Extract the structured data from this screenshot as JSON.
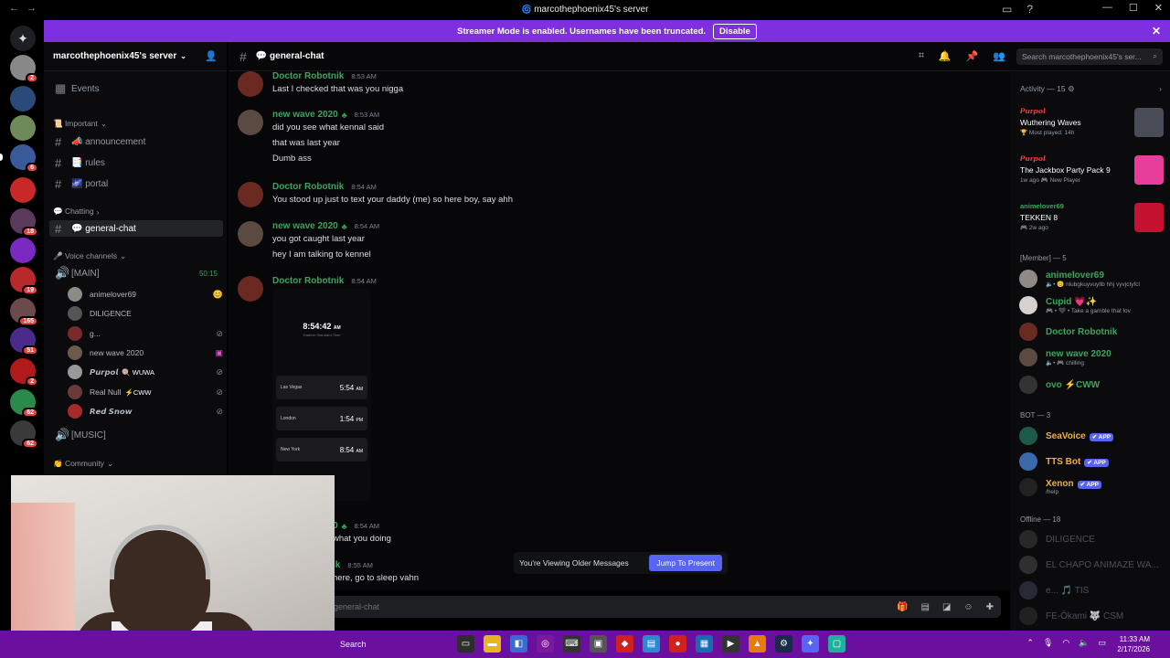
{
  "window": {
    "title": "marcothephoenix45's server"
  },
  "banner": {
    "text": "Streamer Mode is enabled. Usernames have been truncated.",
    "disable_label": "Disable"
  },
  "rail_badges": [
    "2",
    "6",
    "18",
    "19",
    "165",
    "51",
    "2",
    "62",
    "62"
  ],
  "server": {
    "name": "marcothephoenix45's server"
  },
  "channels": {
    "events_label": "Events",
    "important_label": "📜 Important",
    "announcement": "📣 announcement",
    "rules": "📑 rules",
    "portal": "🌌 portal",
    "chatting_label": "💬 Chatting",
    "general": "💬 general-chat",
    "voice_label": "🎤 Voice channels",
    "main_voice": "[MAIN]",
    "main_timer": "50:15",
    "music_voice": "[MUSIC]",
    "community_label": "👏 Community"
  },
  "voice_users": [
    {
      "name": "animelover69",
      "color": "#8e8a86"
    },
    {
      "name": "DILIGENCE",
      "color": "#555"
    },
    {
      "name": "g...",
      "color": "#7a2a2a"
    },
    {
      "name": "new wave 2020",
      "color": "#6b5a4a"
    },
    {
      "name": "𝙋𝙪𝙧𝙥𝙤𝙡",
      "tag": "🍭 WUWA",
      "color": "#999"
    },
    {
      "name": "Real Null",
      "tag": "⚡CWW",
      "color": "#6a3a3a"
    },
    {
      "name": "𝙍𝙚𝙙 𝙎𝙣𝙤𝙬",
      "color": "#a52a2a"
    }
  ],
  "chat": {
    "channel_name": "💬 general-chat",
    "search_placeholder": "Search marcothephoenix45's ser...",
    "messages": [
      {
        "author": "Doctor Robotnik",
        "time": "8:53 AM",
        "lines": [
          "Last I checked that was you nigga"
        ]
      },
      {
        "author": "new wave 2020",
        "time": "8:53 AM",
        "lines": [
          "did you see what kennal said",
          "that was last year",
          "Dumb ass"
        ]
      },
      {
        "author": "Doctor Robotnik",
        "time": "8:54 AM",
        "lines": [
          "You stood up just to text your daddy (me) so here boy, say ahh"
        ]
      },
      {
        "author": "new wave 2020",
        "time": "8:54 AM",
        "lines": [
          "you got caught last year",
          "hey I am talking to kennel"
        ]
      },
      {
        "author": "Doctor Robotnik",
        "time": "8:54 AM",
        "lines": []
      }
    ],
    "partial_messages": [
      {
        "author_tail": "0",
        "time": "8:54 AM",
        "line": "what you doing"
      },
      {
        "author_tail": "ik",
        "time": "8:55 AM",
        "line": "here, go to sleep vahn"
      }
    ],
    "phone": {
      "time": "8:54:42",
      "ampm": "AM",
      "zone": "Eastern Standard Time",
      "clocks": [
        {
          "city": "Las Vegas",
          "time": "5:54",
          "ampm": "AM"
        },
        {
          "city": "London",
          "time": "1:54",
          "ampm": "PM"
        },
        {
          "city": "New York",
          "time": "8:54",
          "ampm": "AM"
        }
      ]
    },
    "older_text": "You're Viewing Older Messages",
    "jump_label": "Jump To Present",
    "composer_placeholder": "general-chat"
  },
  "members": {
    "activity_header": "Activity — 15 ⚙",
    "activities": [
      {
        "who": "𝙋𝙪𝙧𝙥𝙤𝙡",
        "game": "Wuthering Waves",
        "meta": "🏆 Most played: 14h",
        "art": "#4a4d57"
      },
      {
        "who": "𝙋𝙪𝙧𝙥𝙤𝙡",
        "game": "The Jackbox Party Pack 9",
        "meta": "1w ago 🎮 New Player",
        "art": "#e83e9b"
      },
      {
        "who": "animelover69",
        "game": "TEKKEN 8",
        "meta": "🎮 2w ago",
        "art": "#c41230"
      }
    ],
    "member_header": "[Member] — 5",
    "online": [
      {
        "name": "animelover69",
        "status": "🔈• 😊 nlubgkuyvuyllb hhj vyvjctyfcl",
        "color": "#3ba55c"
      },
      {
        "name": "Cupid 💗✨",
        "status": "🎮 • 🖤 • Take a gamble that lov",
        "color": "#3ba55c"
      },
      {
        "name": "Doctor Robotnik",
        "status": "",
        "color": "#3ba55c"
      },
      {
        "name": "new wave 2020",
        "status": "🔈• 🎮 chilling",
        "color": "#3ba55c"
      },
      {
        "name": "ovo ⚡CWW",
        "status": "",
        "color": "#3ba55c"
      }
    ],
    "bot_header": "BOT — 3",
    "bots": [
      {
        "name": "SeaVoice",
        "status": "",
        "tag": "✔ APP",
        "color": "#f0b232"
      },
      {
        "name": "TTS Bot",
        "status": "",
        "tag": "✔ APP",
        "color": "#f0b232"
      },
      {
        "name": "Xenon",
        "status": "/help",
        "tag": "✔ APP",
        "color": "#f0b232"
      }
    ],
    "offline_header": "Offline — 18",
    "offline": [
      {
        "name": "DILIGENCE"
      },
      {
        "name": "EL CHAPO ANIMAZE WA..."
      },
      {
        "name": "e... 🎵 TIS"
      },
      {
        "name": "FE-Ōkami 🐺 CSM"
      }
    ]
  },
  "taskbar": {
    "search_label": "Search",
    "time": "11:33 AM",
    "date": "2/17/2026"
  }
}
